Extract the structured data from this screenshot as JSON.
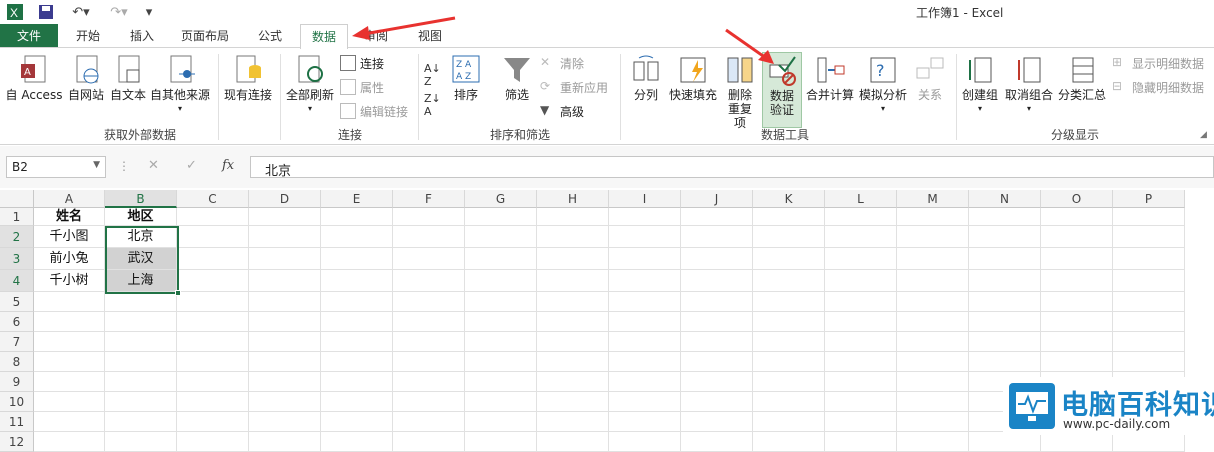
{
  "window": {
    "title": "工作簿1 - Excel"
  },
  "tabs": [
    "文件",
    "开始",
    "插入",
    "页面布局",
    "公式",
    "数据",
    "审阅",
    "视图"
  ],
  "ribbon": {
    "get_external": {
      "label": "获取外部数据",
      "buttons": [
        "自 Access",
        "自网站",
        "自文本",
        "自其他来源",
        "现有连接"
      ]
    },
    "connections": {
      "label": "连接",
      "refresh_all": "全部刷新",
      "small": [
        "连接",
        "属性",
        "编辑链接"
      ]
    },
    "sort_filter": {
      "label": "排序和筛选",
      "sort": "排序",
      "filter": "筛选",
      "small": [
        "清除",
        "重新应用",
        "高级"
      ]
    },
    "data_tools": {
      "label": "数据工具",
      "buttons": [
        "分列",
        "快速填充",
        "删除重复项",
        "数据验证",
        "合并计算",
        "模拟分析",
        "关系"
      ]
    },
    "outline": {
      "label": "分级显示",
      "buttons": [
        "创建组",
        "取消组合",
        "分类汇总"
      ],
      "small": [
        "显示明细数据",
        "隐藏明细数据"
      ]
    }
  },
  "formula_bar": {
    "name_box": "B2",
    "fx": "fx",
    "value": "北京"
  },
  "columns": [
    "A",
    "B",
    "C",
    "D",
    "E",
    "F",
    "G",
    "H",
    "I",
    "J",
    "K",
    "L",
    "M",
    "N",
    "O",
    "P"
  ],
  "rows": [
    "1",
    "2",
    "3",
    "4",
    "5",
    "6",
    "7",
    "8",
    "9",
    "10",
    "11",
    "12"
  ],
  "cells": [
    [
      "姓名",
      "地区"
    ],
    [
      "千小图",
      "北京"
    ],
    [
      "前小兔",
      "武汉"
    ],
    [
      "千小树",
      "上海"
    ]
  ],
  "watermark": {
    "brand": "电脑百科知识",
    "url": "www.pc-daily.com"
  },
  "colors": {
    "accent": "#217346",
    "arrow": "#e8322f"
  }
}
